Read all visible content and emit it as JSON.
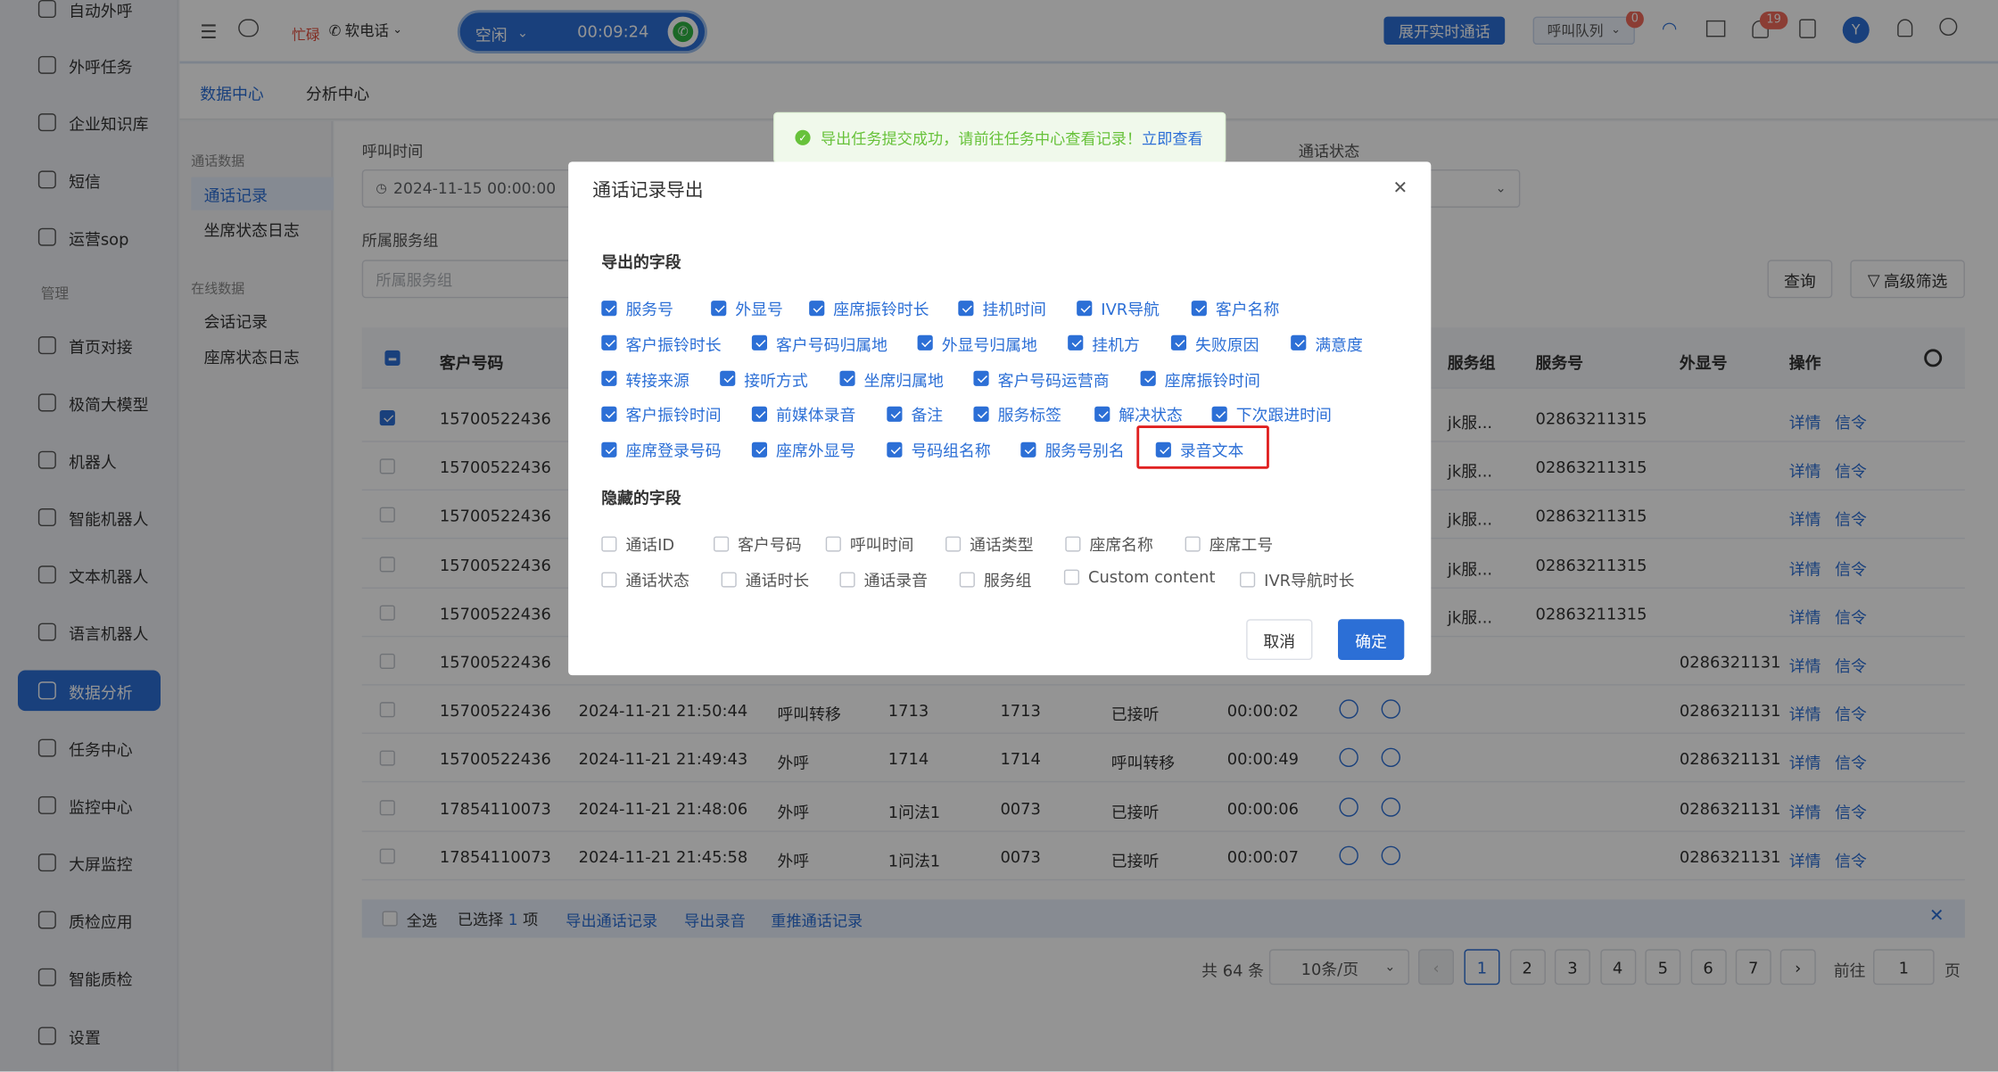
{
  "sidebar": {
    "items": [
      {
        "label": "自动外呼",
        "icon": "auto-dial-icon"
      },
      {
        "label": "外呼任务",
        "icon": "phone-task-icon"
      },
      {
        "label": "企业知识库",
        "icon": "book-icon"
      },
      {
        "label": "短信",
        "icon": "sms-icon"
      },
      {
        "label": "运营sop",
        "icon": "sop-icon"
      },
      {
        "label": "首页对接",
        "icon": "chart-board-icon"
      },
      {
        "label": "极简大模型",
        "icon": "model-icon"
      },
      {
        "label": "机器人",
        "icon": "robot-icon"
      },
      {
        "label": "智能机器人",
        "icon": "smart-robot-icon"
      },
      {
        "label": "文本机器人",
        "icon": "text-robot-icon"
      },
      {
        "label": "语言机器人",
        "icon": "voice-robot-icon"
      },
      {
        "label": "数据分析",
        "icon": "bar-chart-icon"
      },
      {
        "label": "任务中心",
        "icon": "task-icon"
      },
      {
        "label": "监控中心",
        "icon": "monitor-icon"
      },
      {
        "label": "大屏监控",
        "icon": "screen-icon"
      },
      {
        "label": "质检应用",
        "icon": "qa-icon"
      },
      {
        "label": "智能质检",
        "icon": "smart-qa-icon"
      },
      {
        "label": "设置",
        "icon": "gear-icon"
      }
    ],
    "section_manage": "管理"
  },
  "header": {
    "status_busy": "忙碌",
    "phone_mode": "软电话",
    "idle_label": "空闲",
    "timer": "00:09:24",
    "expand_call": "展开实时通话",
    "call_queue": "呼叫队列",
    "queue_badge": "0",
    "notif_badge": "19",
    "avatar_letter": "Y"
  },
  "subnav": {
    "tab1": "数据中心",
    "tab2": "分析中心"
  },
  "secondary": {
    "head1": "通话数据",
    "item1": "通话记录",
    "item2": "坐席状态日志",
    "head2": "在线数据",
    "item3": "会话记录",
    "item4": "座席状态日志"
  },
  "toast": {
    "text": "导出任务提交成功，请前往任务中心查看记录！",
    "link": "立即查看"
  },
  "filters": {
    "call_time_label": "呼叫时间",
    "call_time_value": "2024-11-15 00:00:00",
    "group_label": "所属服务组",
    "group_placeholder": "所属服务组",
    "status_label": "通话状态",
    "query": "查询",
    "advanced": "高级筛选"
  },
  "table": {
    "col_customer": "客户号码",
    "col_group": "服务组",
    "col_service": "服务号",
    "col_display": "外显号",
    "col_ops": "操作",
    "detail": "详情",
    "signal": "信令",
    "rows": [
      {
        "phone": "15700522436",
        "time": "",
        "type": "",
        "seat": "",
        "ext": "",
        "result": "",
        "dur": "",
        "group": "jk服...",
        "service": "02863211315",
        "display": ""
      },
      {
        "phone": "15700522436",
        "time": "",
        "type": "",
        "seat": "",
        "ext": "",
        "result": "",
        "dur": "",
        "group": "jk服...",
        "service": "02863211315",
        "display": ""
      },
      {
        "phone": "15700522436",
        "time": "",
        "type": "",
        "seat": "",
        "ext": "",
        "result": "",
        "dur": "",
        "group": "jk服...",
        "service": "02863211315",
        "display": ""
      },
      {
        "phone": "15700522436",
        "time": "",
        "type": "",
        "seat": "",
        "ext": "",
        "result": "",
        "dur": "",
        "group": "jk服...",
        "service": "02863211315",
        "display": ""
      },
      {
        "phone": "15700522436",
        "time": "",
        "type": "",
        "seat": "",
        "ext": "",
        "result": "",
        "dur": "",
        "group": "jk服...",
        "service": "02863211315",
        "display": ""
      },
      {
        "phone": "15700522436",
        "time": "",
        "type": "",
        "seat": "",
        "ext": "",
        "result": "",
        "dur": "",
        "group": "",
        "service": "",
        "display": "0286321131"
      },
      {
        "phone": "15700522436",
        "time": "2024-11-21 21:50:44",
        "type": "呼叫转移",
        "seat": "1713",
        "ext": "1713",
        "result": "已接听",
        "dur": "00:00:02",
        "group": "",
        "service": "",
        "display": "0286321131"
      },
      {
        "phone": "15700522436",
        "time": "2024-11-21 21:49:43",
        "type": "外呼",
        "seat": "1714",
        "ext": "1714",
        "result": "呼叫转移",
        "dur": "00:00:49",
        "group": "",
        "service": "",
        "display": "0286321131"
      },
      {
        "phone": "17854110073",
        "time": "2024-11-21 21:48:06",
        "type": "外呼",
        "seat": "1问法1",
        "ext": "0073",
        "result": "已接听",
        "dur": "00:00:06",
        "group": "",
        "service": "",
        "display": "0286321131"
      },
      {
        "phone": "17854110073",
        "time": "2024-11-21 21:45:58",
        "type": "外呼",
        "seat": "1问法1",
        "ext": "0073",
        "result": "已接听",
        "dur": "00:00:07",
        "group": "",
        "service": "",
        "display": "0286321131"
      }
    ]
  },
  "bulk": {
    "select_all": "全选",
    "selected_prefix": "已选择",
    "selected_count": "1",
    "selected_suffix": "项",
    "export_calls": "导出通话记录",
    "export_recordings": "导出录音",
    "rerun": "重推通话记录"
  },
  "pagination": {
    "total": "共 64 条",
    "page_size": "10条/页",
    "pages": [
      "1",
      "2",
      "3",
      "4",
      "5",
      "6",
      "7"
    ],
    "goto": "前往",
    "goto_value": "1",
    "page_suffix": "页"
  },
  "modal": {
    "title": "通话记录导出",
    "export_section": "导出的字段",
    "hidden_section": "隐藏的字段",
    "export_fields": [
      [
        "服务号",
        "外显号",
        "座席振铃时长",
        "挂机时间",
        "IVR导航",
        "客户名称"
      ],
      [
        "客户振铃时长",
        "客户号码归属地",
        "外显号归属地",
        "挂机方",
        "失败原因",
        "满意度"
      ],
      [
        "转接来源",
        "接听方式",
        "坐席归属地",
        "客户号码运营商",
        "座席振铃时间"
      ],
      [
        "客户振铃时间",
        "前媒体录音",
        "备注",
        "服务标签",
        "解决状态",
        "下次跟进时间"
      ],
      [
        "座席登录号码",
        "座席外显号",
        "号码组名称",
        "服务号别名",
        "录音文本"
      ]
    ],
    "hidden_fields": [
      [
        "通话ID",
        "客户号码",
        "呼叫时间",
        "通话类型",
        "座席名称",
        "座席工号"
      ],
      [
        "通话状态",
        "通话时长",
        "通话录音",
        "服务组",
        "Custom content",
        "IVR导航时长"
      ]
    ],
    "cancel": "取消",
    "confirm": "确定",
    "highlight_color": "#e02020"
  },
  "colors": {
    "primary": "#2c6fd6",
    "success": "#2fb344"
  }
}
